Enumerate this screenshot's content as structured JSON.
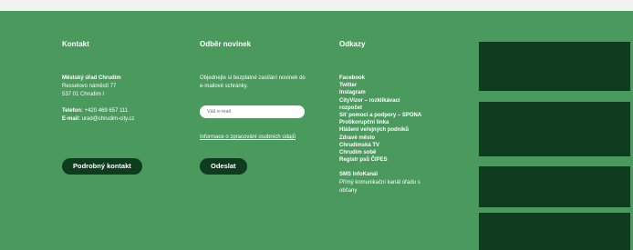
{
  "contact": {
    "heading": "Kontakt",
    "office_name": "Městský úřad Chrudim",
    "address_line1": "Resselovo náměstí 77",
    "address_line2": "537 01 Chrudim I",
    "phone_label": "Telefon:",
    "phone_value": "+420 469 657 111",
    "email_label": "E-mail:",
    "email_value": "urad@chrudim-city.cz",
    "button_label": "Podrobný kontakt"
  },
  "newsletter": {
    "heading": "Odběr novinek",
    "description": "Objednejte si bezplatné zasílání novinek do e-mailové schránky.",
    "email_placeholder": "Váš e-mail",
    "privacy_link": "Informace o zpracování osobních údajů",
    "submit_label": "Odeslat"
  },
  "links": {
    "heading": "Odkazy",
    "items": [
      "Facebook",
      "Twitter",
      "Instagram",
      "CityVizor – rozklikávací rozpočet",
      "Síť pomoci a podpory – SPONA",
      "Protikorupční linka",
      "Hlášení veřejných podniků",
      "Zdravé město",
      "Chrudimská TV",
      "Chrudim sobě",
      "Registr psů ČIPES"
    ],
    "sms_title": "SMS InfoKanál",
    "sms_desc": "Přímý komunikační kanál úřadu s občany"
  },
  "colors": {
    "background": "#4a9a5e",
    "dark_box": "#0f3b1f",
    "top_strip": "#f2f2f2"
  }
}
